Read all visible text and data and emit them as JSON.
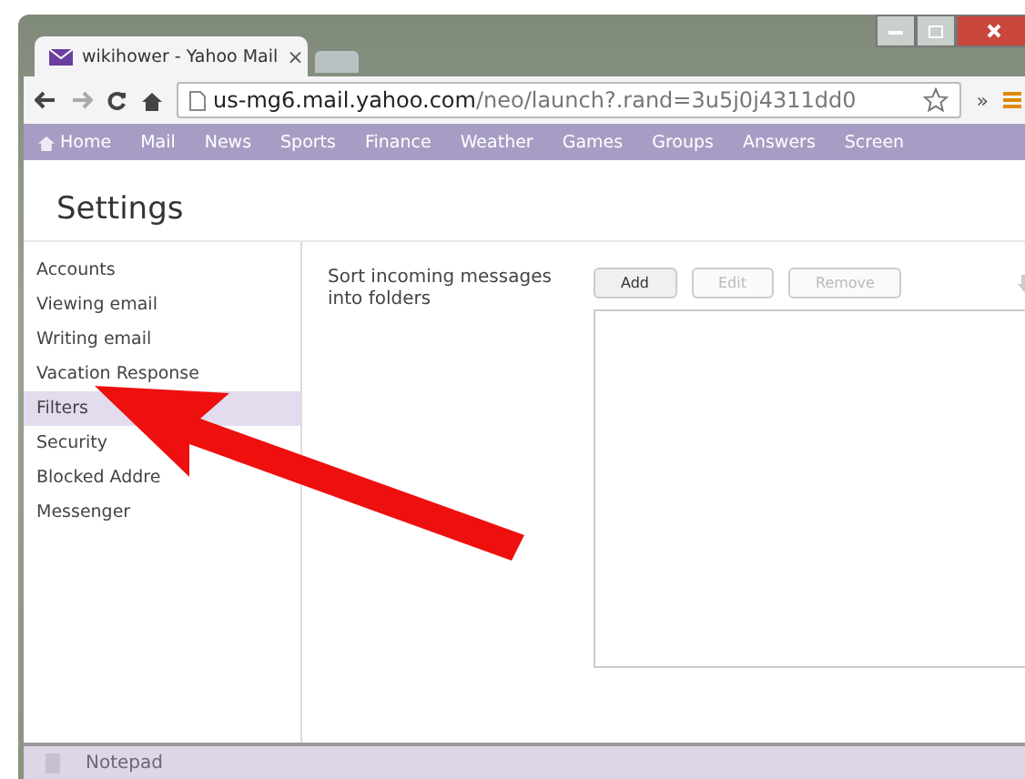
{
  "browser": {
    "tab_title": "wikihower - Yahoo Mail",
    "tab_close": "×",
    "url_host": "us-mg6.mail.yahoo.com",
    "url_path": "/neo/launch?.rand=3u5j0j4311dd0",
    "overflow": "»"
  },
  "nav": [
    {
      "label": "Home",
      "kind": "home"
    },
    {
      "label": "Mail",
      "kind": "link"
    },
    {
      "label": "News",
      "kind": "link"
    },
    {
      "label": "Sports",
      "kind": "link"
    },
    {
      "label": "Finance",
      "kind": "link"
    },
    {
      "label": "Weather",
      "kind": "link"
    },
    {
      "label": "Games",
      "kind": "link"
    },
    {
      "label": "Groups",
      "kind": "link"
    },
    {
      "label": "Answers",
      "kind": "link"
    },
    {
      "label": "Screen",
      "kind": "link"
    }
  ],
  "page_title": "Settings",
  "sidebar": [
    {
      "label": "Accounts",
      "selected": false
    },
    {
      "label": "Viewing email",
      "selected": false
    },
    {
      "label": "Writing email",
      "selected": false
    },
    {
      "label": "Vacation Response",
      "selected": false
    },
    {
      "label": "Filters",
      "selected": true
    },
    {
      "label": "Security",
      "selected": false
    },
    {
      "label": "Blocked Addre",
      "selected": false
    },
    {
      "label": "Messenger",
      "selected": false
    }
  ],
  "filters": {
    "description": "Sort incoming messages into folders",
    "buttons": [
      {
        "label": "Add",
        "disabled": false
      },
      {
        "label": "Edit",
        "disabled": true
      },
      {
        "label": "Remove",
        "disabled": true
      }
    ]
  },
  "taskbar": {
    "item": "Notepad"
  }
}
